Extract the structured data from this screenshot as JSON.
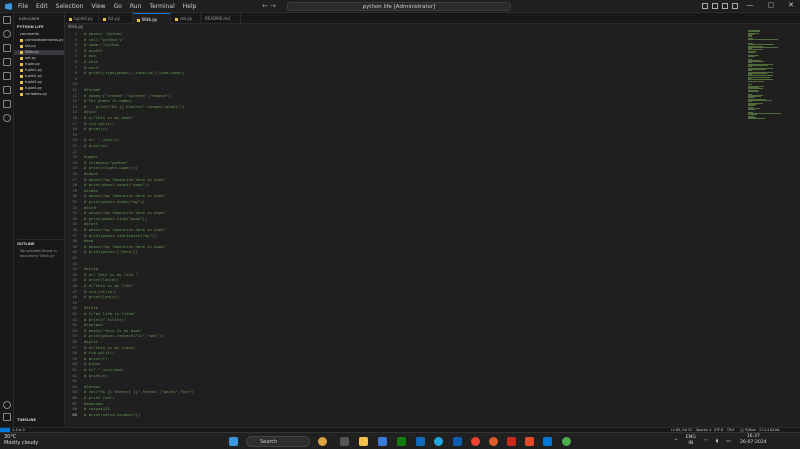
{
  "titlebar": {
    "menu": [
      "File",
      "Edit",
      "Selection",
      "View",
      "Go",
      "Run",
      "Terminal",
      "Help"
    ],
    "search": "python life [Administrator]",
    "nav": "← →",
    "window_controls": [
      "—",
      "▢",
      "✕"
    ]
  },
  "sidebar": {
    "header": "EXPLORER",
    "folder": "PYTHON LIFE",
    "files": [
      "comments",
      "controlstatements.py",
      "list.py",
      "llllkk.py",
      "set.py",
      "tuple.py",
      "tuple1.py",
      "tuple2.py",
      "tuple3.py",
      "tuple4.py",
      "variables.py"
    ],
    "selected": "llllkk.py",
    "outline_header": "OUTLINE",
    "outline_message": "No symbols found in document 'llllkk.py'",
    "timeline_header": "TIMELINE"
  },
  "tabs": [
    "tuple4.py",
    "list.py",
    "llllkk.py",
    "set.py",
    "README.md"
  ],
  "active_tab": "llllkk.py",
  "breadcrumb": "llllkk.py",
  "code": [
    {
      "n": "1",
      "t": "# phani= 'python'"
    },
    {
      "n": "2",
      "t": "# val= \"python's\""
    },
    {
      "n": "3",
      "t": "# name:'\"python"
    },
    {
      "n": "4",
      "t": "# a=w4ff"
    },
    {
      "n": "5",
      "t": "# bna"
    },
    {
      "n": "6",
      "t": "# text"
    },
    {
      "n": "7",
      "t": "# wert\""
    },
    {
      "n": "8",
      "t": "# print((type(phani)),type(val),type(name))"
    },
    {
      "n": "9",
      "t": ""
    },
    {
      "n": "10",
      "t": ""
    },
    {
      "n": "11",
      "t": "#format"
    },
    {
      "n": "12",
      "t": "# names=[\"sreeha\",\"sateesh\",\"ramesh\"]"
    },
    {
      "n": "13",
      "t": "# for phani in names:"
    },
    {
      "n": "14",
      "t": "#    print(\"Hi {} hteerut\".format(\"phani\"))"
    },
    {
      "n": "15",
      "t": "#join"
    },
    {
      "n": "16",
      "t": "# a=\"this is my book\""
    },
    {
      "n": "17",
      "t": "# c=d.split()"
    },
    {
      "n": "18",
      "t": "# print(c)"
    },
    {
      "n": "19",
      "t": ""
    },
    {
      "n": "20",
      "t": "# e=\" \".join(c)"
    },
    {
      "n": "21",
      "t": "# print(e)"
    },
    {
      "n": "22",
      "t": ""
    },
    {
      "n": "23",
      "t": "#upper"
    },
    {
      "n": "24",
      "t": "# st=phani=\"python\""
    },
    {
      "n": "25",
      "t": "# print(st+phn.upper())"
    },
    {
      "n": "26",
      "t": "#count"
    },
    {
      "n": "27",
      "t": "# phani=\"my favourite hero is pspk\""
    },
    {
      "n": "28",
      "t": "# print(phani.count(\"pspk\"))"
    },
    {
      "n": "29",
      "t": "#index"
    },
    {
      "n": "30",
      "t": "# phani=\"my favourite hero is pspk\""
    },
    {
      "n": "31",
      "t": "# print(phani.index(\"my\"))"
    },
    {
      "n": "32",
      "t": "#find"
    },
    {
      "n": "33",
      "t": "# phani=\"my favourite hero is pspk\""
    },
    {
      "n": "34",
      "t": "# print(phani.find(\"pspk\"))"
    },
    {
      "n": "35",
      "t": "#start"
    },
    {
      "n": "36",
      "t": "# phani=\"my favourite hero is pspk\""
    },
    {
      "n": "37",
      "t": "# print(phani.startswith(\"my\"))"
    },
    {
      "n": "38",
      "t": "#end"
    },
    {
      "n": "39",
      "t": "# phani=\"my favourite hero is pspk\""
    },
    {
      "n": "40",
      "t": "# print(phani.[\"hero\"])"
    },
    {
      "n": "41",
      "t": ""
    },
    {
      "n": "42",
      "t": ""
    },
    {
      "n": "43",
      "t": "#strip"
    },
    {
      "n": "44",
      "t": "# d=\" this is my life \""
    },
    {
      "n": "45",
      "t": "# print(len(d))"
    },
    {
      "n": "46",
      "t": "# d=\"this is my life\""
    },
    {
      "n": "47",
      "t": "# x=d.rstrip()"
    },
    {
      "n": "48",
      "t": "# print(len(x))"
    },
    {
      "n": "49",
      "t": ""
    },
    {
      "n": "50",
      "t": "#title"
    },
    {
      "n": "51",
      "t": "# f=\"my life is litem\""
    },
    {
      "n": "52",
      "t": "# print(f.title())"
    },
    {
      "n": "53",
      "t": "#replace"
    },
    {
      "n": "54",
      "t": "# phani=\"this is my book\""
    },
    {
      "n": "55",
      "t": "# print(phani.replace(\"is\",\"ask\"))"
    },
    {
      "n": "56",
      "t": "#split"
    },
    {
      "n": "57",
      "t": "# d=\"this is my class\""
    },
    {
      "n": "58",
      "t": "# f=d.split()"
    },
    {
      "n": "59",
      "t": "# print(f)"
    },
    {
      "n": "60",
      "t": "# #join"
    },
    {
      "n": "61",
      "t": "# e=\" \".join(one)"
    },
    {
      "n": "62",
      "t": "# print(e)"
    },
    {
      "n": "63",
      "t": ""
    },
    {
      "n": "64",
      "t": "#format"
    },
    {
      "n": "65",
      "t": "# val=\"Hi {} hteerut {}\".format (\"phani\",\"bye\")"
    },
    {
      "n": "66",
      "t": "# print (val)"
    },
    {
      "n": "67",
      "t": "#imezuam"
    },
    {
      "n": "68",
      "t": "# tatyus123"
    },
    {
      "n": "69",
      "t": "# print(satya.isupper())"
    }
  ],
  "statusbar": {
    "items": [
      "Ln 69, Col 21",
      "Spaces: 4",
      "UTF-8",
      "CRLF",
      "{} Python",
      "3.11.4 64-bit"
    ],
    "left": "⚠ 0  ⊗ 0"
  },
  "taskbar": {
    "weather_temp": "30°C",
    "weather_desc": "Mostly cloudy",
    "search": "Search",
    "lang": "ENG",
    "region": "IN",
    "time": "16:37",
    "date": "26-07-2024"
  }
}
